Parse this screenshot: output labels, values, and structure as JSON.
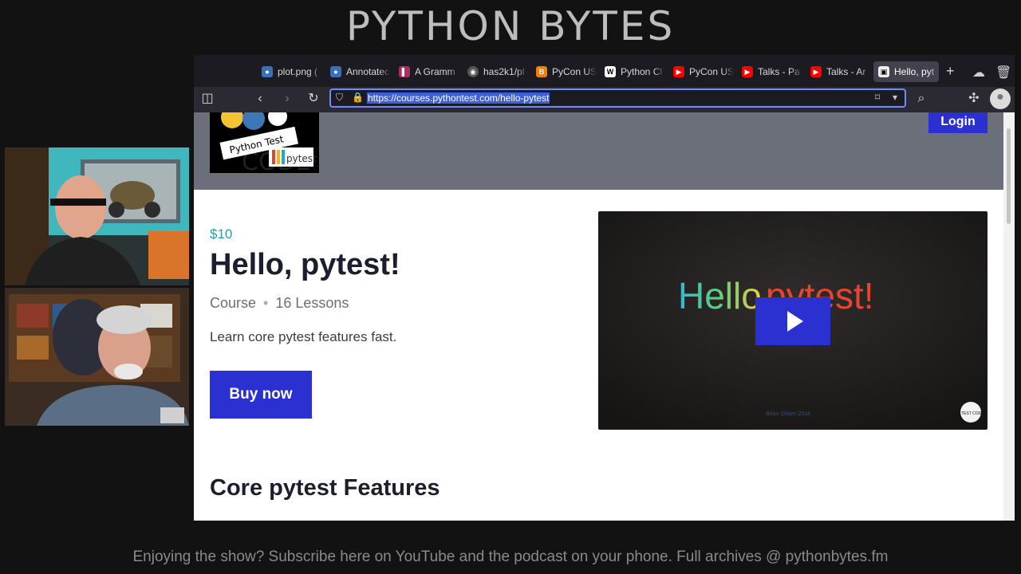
{
  "show": {
    "title": "PYTHON BYTES",
    "footer": "Enjoying the show? Subscribe here on YouTube and the podcast on your phone. Full archives @ pythonbytes.fm"
  },
  "browser": {
    "tabs": [
      {
        "label": "plot.png (",
        "icon": "python-icon",
        "color": "#3b6fb6"
      },
      {
        "label": "Annotatec",
        "icon": "python-icon",
        "color": "#3b6fb6"
      },
      {
        "label": "A Gramm",
        "icon": "document-icon",
        "color": "#b02a6a"
      },
      {
        "label": "has2k1/pl",
        "icon": "github-icon",
        "color": "#333333"
      },
      {
        "label": "PyCon US",
        "icon": "blogger-icon",
        "color": "#f57d00"
      },
      {
        "label": "Python Cl",
        "icon": "wikipedia-icon",
        "color": "#ffffff"
      },
      {
        "label": "PyCon US",
        "icon": "youtube-icon",
        "color": "#ff0000"
      },
      {
        "label": "Talks - Pa",
        "icon": "youtube-icon",
        "color": "#ff0000"
      },
      {
        "label": "Talks - Ar",
        "icon": "youtube-icon",
        "color": "#ff0000"
      },
      {
        "label": "Hello, pyt",
        "icon": "testandcode-icon",
        "color": "#eeeeee",
        "active": true
      }
    ],
    "url": "https://courses.pythontest.com/hello-pytest"
  },
  "page": {
    "logo_text": "Python Test",
    "logo_badge": "pytest",
    "login_label": "Login",
    "price": "$10",
    "title": "Hello, pytest!",
    "meta_type": "Course",
    "meta_separator": "•",
    "meta_lessons": "16 Lessons",
    "description": "Learn core pytest features fast.",
    "buy_label": "Buy now",
    "video": {
      "title_part1": "Hello",
      "title_part2": " pytest!",
      "credit": "Brian Okken 2024",
      "badge": "TEST CODE"
    },
    "section_title": "Core pytest Features"
  }
}
